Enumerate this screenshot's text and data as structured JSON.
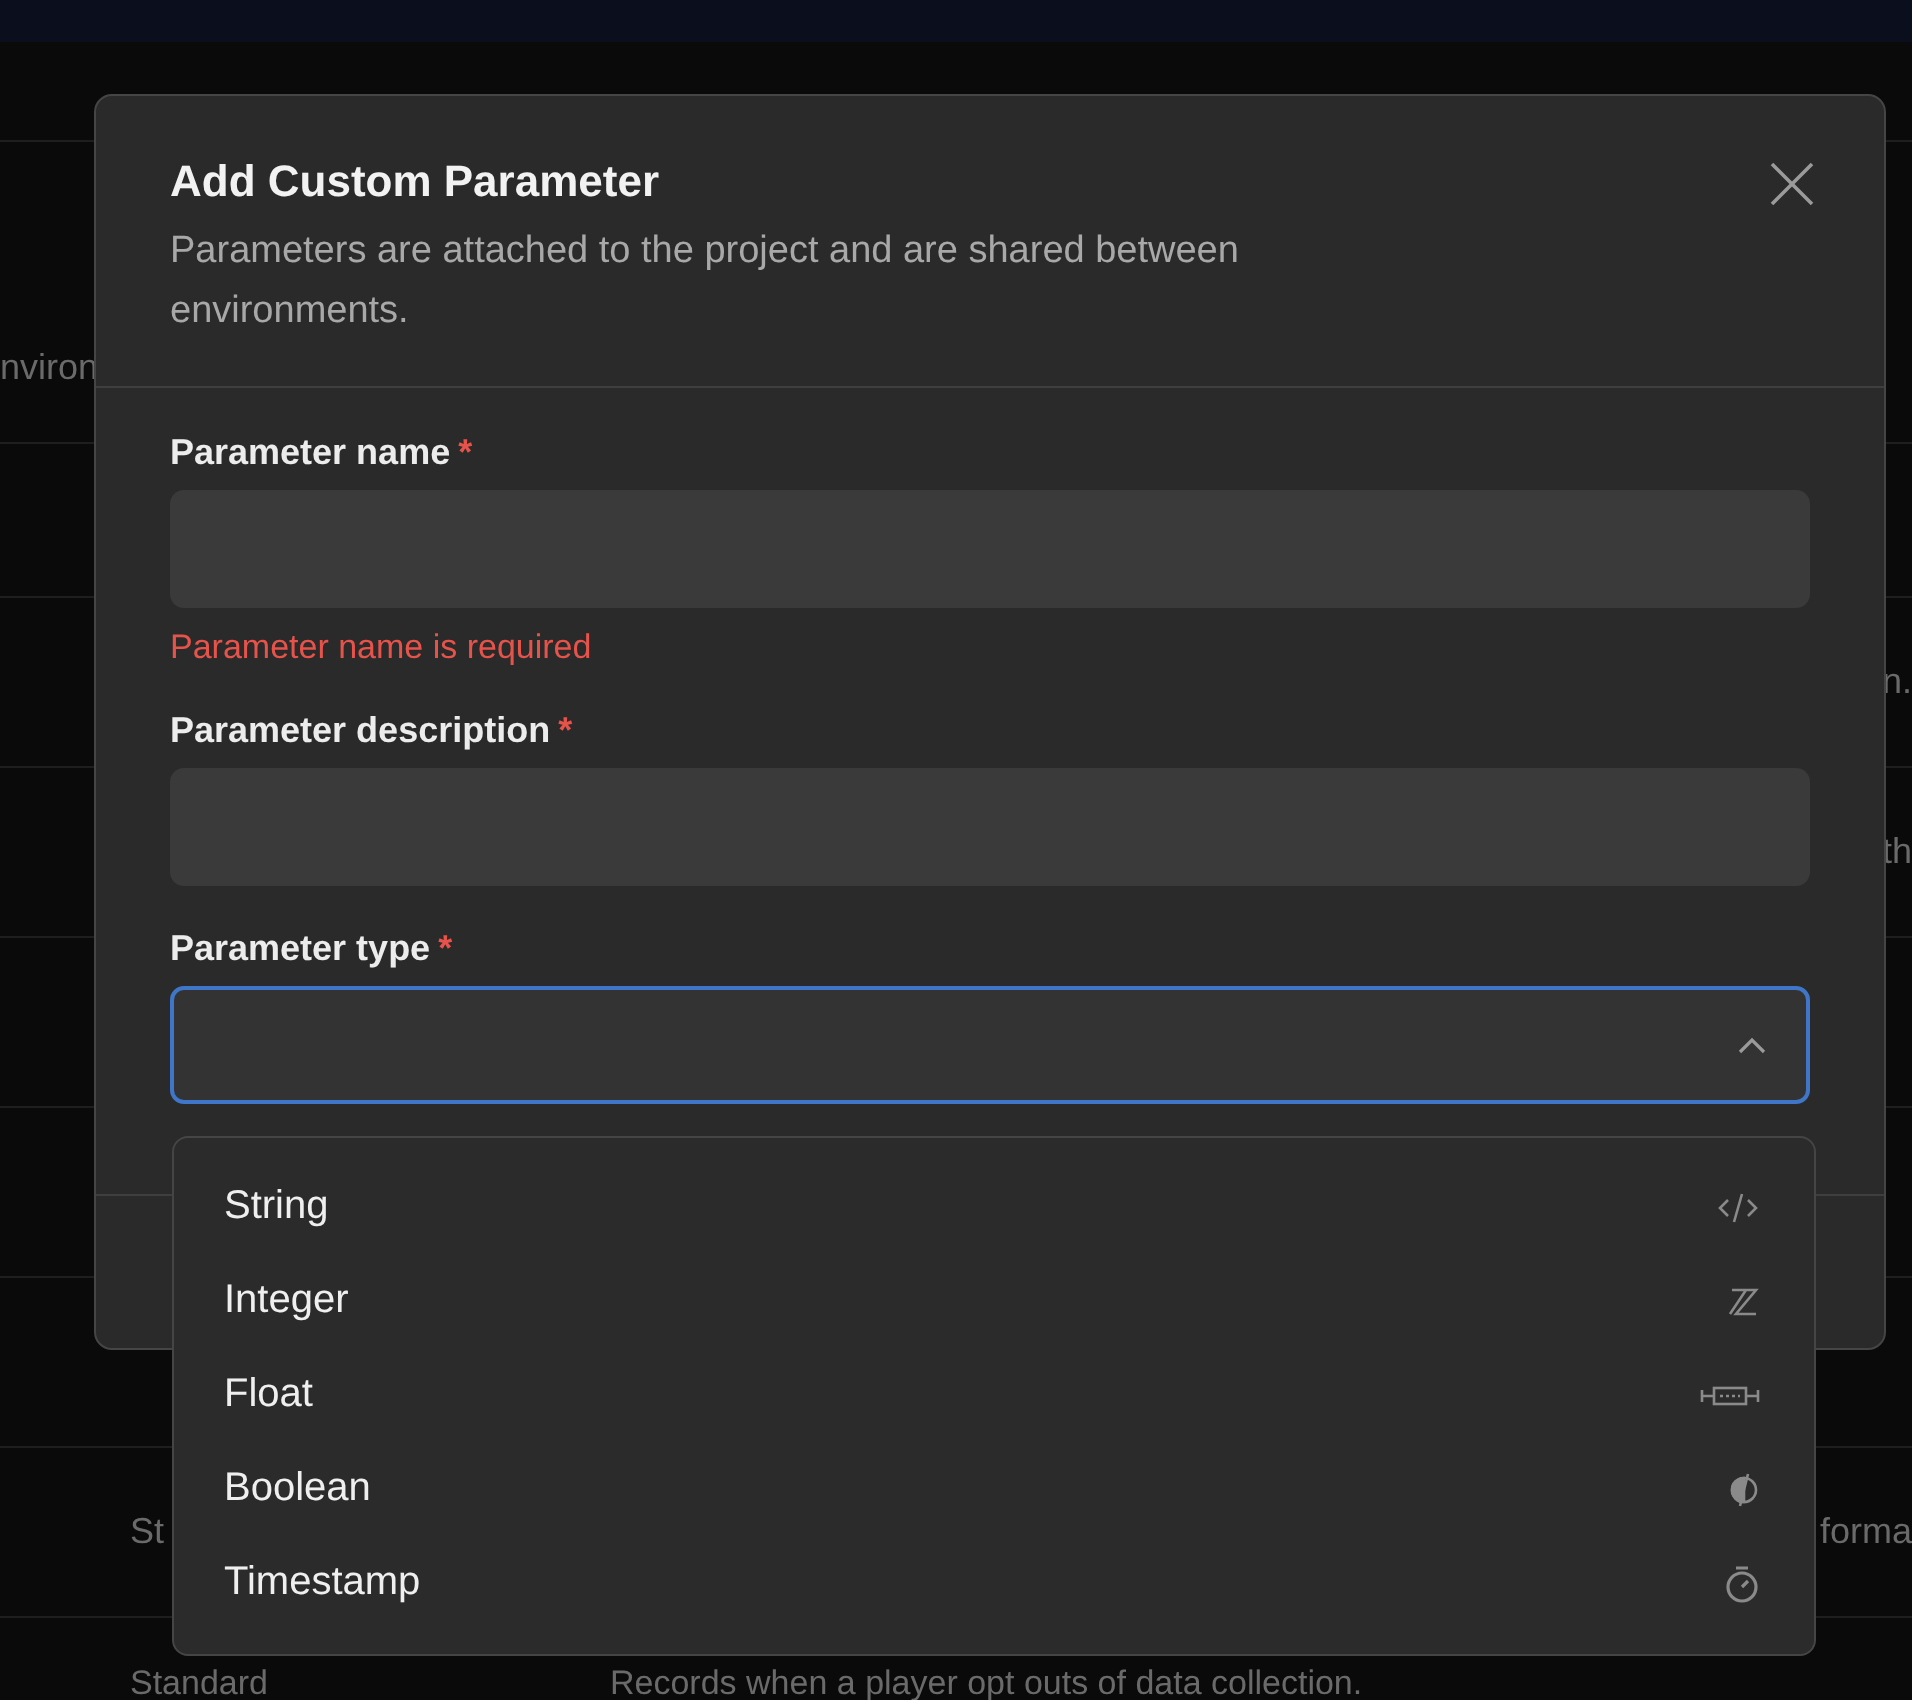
{
  "background_rows": [
    {
      "left": "nviron",
      "right": ""
    },
    {
      "left": "",
      "right": ""
    },
    {
      "left": "",
      "right": "n."
    },
    {
      "left": "",
      "right": "th"
    },
    {
      "left": "",
      "right": ""
    },
    {
      "left": "",
      "right": ""
    },
    {
      "left": "",
      "right": ""
    },
    {
      "left": "St",
      "right": "forma"
    },
    {
      "left": "Standard",
      "middle": "Records when a player opt outs of data collection.",
      "right": ""
    }
  ],
  "dialog": {
    "title": "Add Custom Parameter",
    "description": "Parameters are attached to the project and are shared between environments.",
    "fields": [
      {
        "kind": "text",
        "label": "Parameter name",
        "required_mark": "*",
        "error": "Parameter name is required",
        "focused": false
      },
      {
        "kind": "text",
        "label": "Parameter description",
        "required_mark": "*",
        "focused": false
      },
      {
        "kind": "select",
        "label": "Parameter type",
        "required_mark": "*",
        "focused": true,
        "expanded": true
      }
    ]
  },
  "dropdown": {
    "options": [
      {
        "label": "String",
        "kind": "string"
      },
      {
        "label": "Integer",
        "kind": "integer"
      },
      {
        "label": "Float",
        "kind": "float"
      },
      {
        "label": "Boolean",
        "kind": "boolean"
      },
      {
        "label": "Timestamp",
        "kind": "timestamp"
      }
    ]
  }
}
